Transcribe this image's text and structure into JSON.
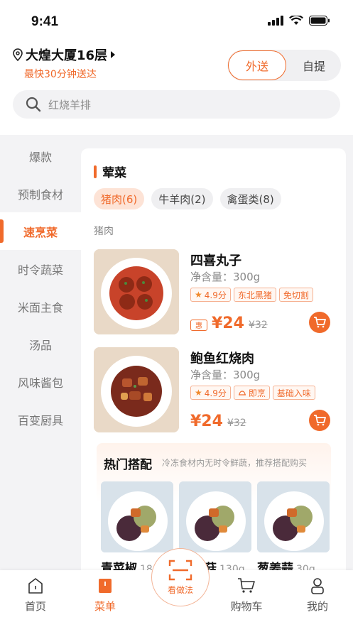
{
  "status_bar": {
    "time": "9:41"
  },
  "header": {
    "location": "大煌大厦16层",
    "delivery_note": "最快30分钟送达",
    "modes": {
      "active": "外送",
      "inactive": "自提"
    },
    "search_placeholder": "红烧羊排"
  },
  "sidebar": {
    "items": [
      {
        "label": "爆款"
      },
      {
        "label": "预制食材"
      },
      {
        "label": "速烹菜"
      },
      {
        "label": "时令蔬菜"
      },
      {
        "label": "米面主食"
      },
      {
        "label": "汤品"
      },
      {
        "label": "风味酱包"
      },
      {
        "label": "百变厨具"
      }
    ],
    "active_index": 2
  },
  "section": {
    "title": "荤菜",
    "chips": [
      {
        "label": "猪肉(6)"
      },
      {
        "label": "牛羊肉(2)"
      },
      {
        "label": "禽蛋类(8)"
      }
    ],
    "sub_heading": "猪肉"
  },
  "products": [
    {
      "name": "四喜丸子",
      "weight": "净含量：300g",
      "tags": [
        "4.9分",
        "东北黑猪",
        "免切割"
      ],
      "price": "¥24",
      "old_price": "¥32",
      "badge": "惠"
    },
    {
      "name": "鲍鱼红烧肉",
      "weight": "净含量：300g",
      "tags": [
        "4.9分",
        "即烹",
        "基础入味"
      ],
      "price": "¥24",
      "old_price": "¥32"
    }
  ],
  "combo": {
    "title": "热门搭配",
    "subtitle": "冷冻食材内无时令鲜蔬，推荐搭配购买",
    "items": [
      {
        "name": "青菜椒",
        "weight": "18"
      },
      {
        "name": "菇",
        "weight": "130g"
      },
      {
        "name": "葱姜蒜",
        "weight": "30g"
      }
    ]
  },
  "fab": {
    "label": "看做法"
  },
  "tabbar": {
    "items": [
      {
        "label": "首页"
      },
      {
        "label": "菜单"
      },
      {
        "label": "购物车"
      },
      {
        "label": "我的"
      }
    ],
    "active_index": 1
  },
  "colors": {
    "accent": "#f06a2b",
    "background": "#f3f3f5"
  }
}
